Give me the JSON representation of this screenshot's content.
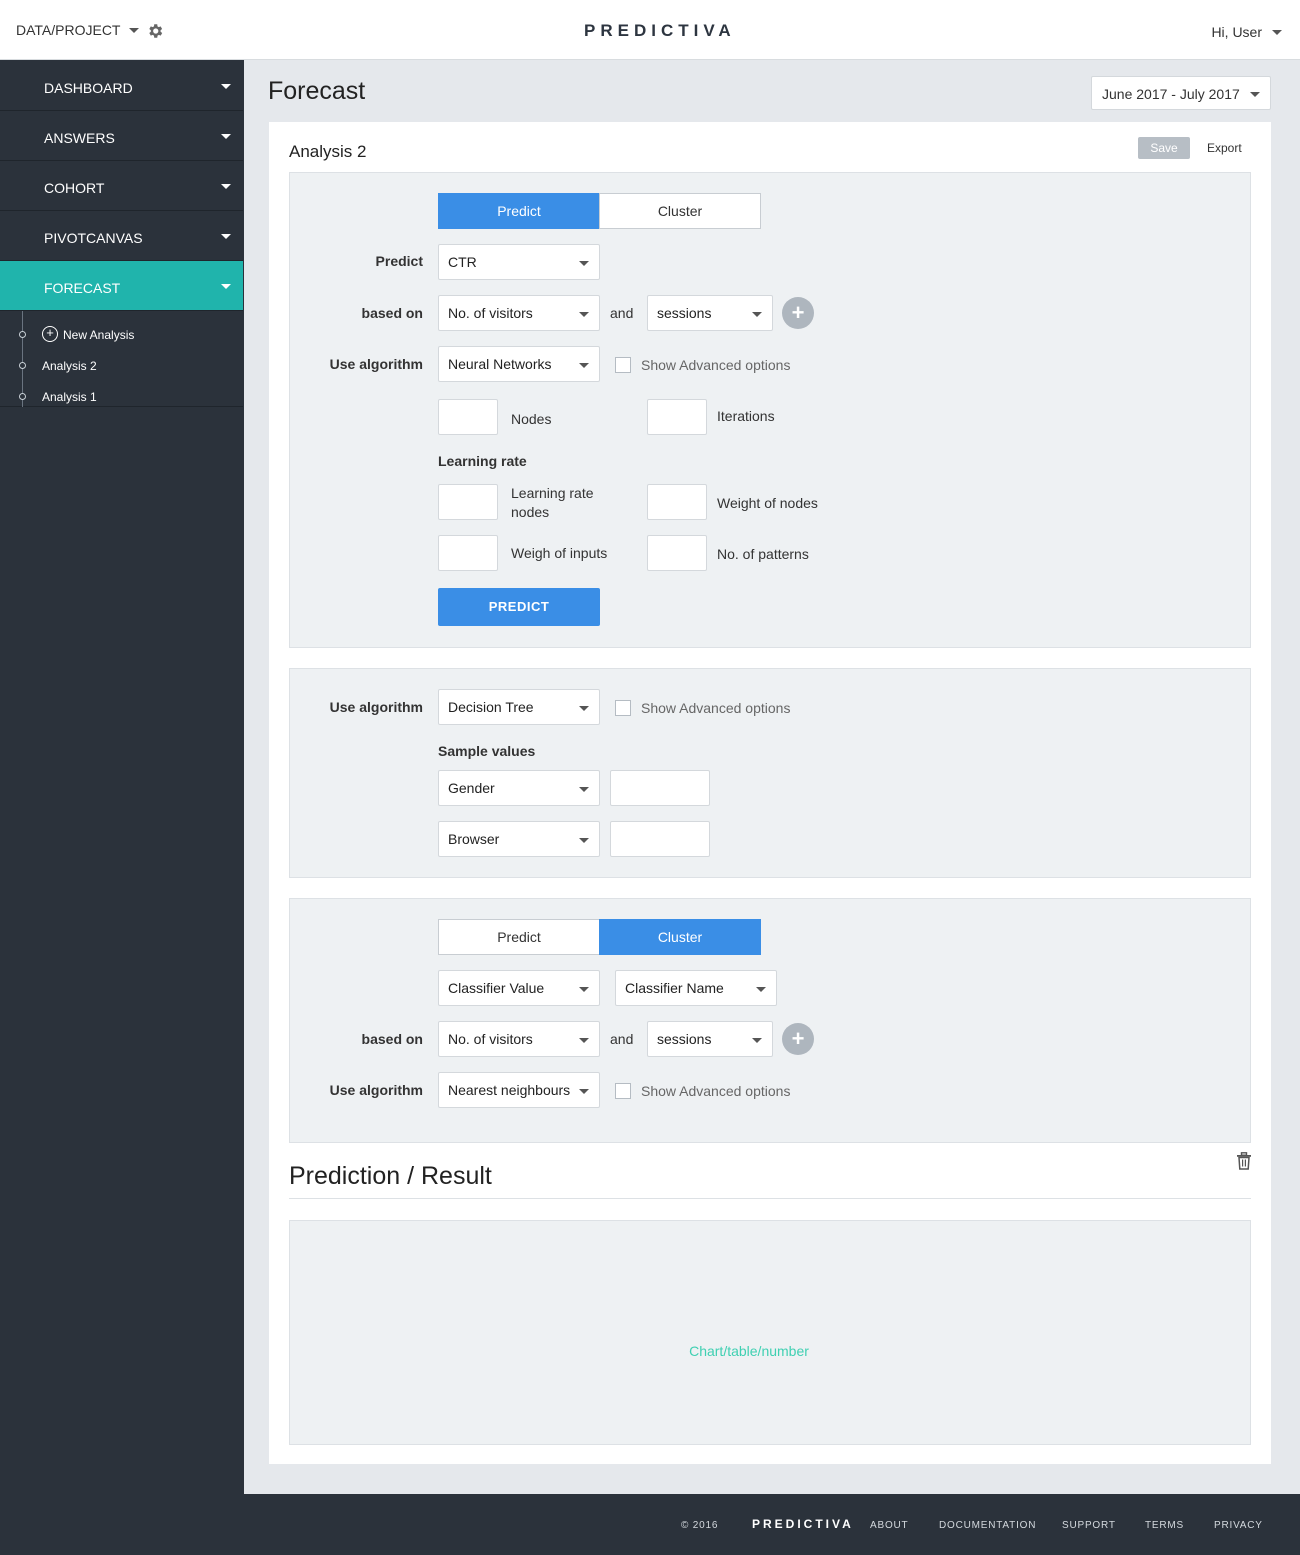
{
  "header": {
    "project_label": "DATA/PROJECT",
    "logo": "PREDICTIVA",
    "user_label": "Hi, User"
  },
  "sidebar": {
    "items": [
      {
        "label": "DASHBOARD"
      },
      {
        "label": "ANSWERS"
      },
      {
        "label": "COHORT"
      },
      {
        "label": "PIVOTCANVAS"
      },
      {
        "label": "FORECAST",
        "active": true
      }
    ],
    "subitems": [
      {
        "label": "New Analysis",
        "icon": "plus-circle-icon"
      },
      {
        "label": "Analysis 2"
      },
      {
        "label": "Analysis 1"
      }
    ]
  },
  "main": {
    "title": "Forecast",
    "date_range": "June 2017 - July 2017",
    "card_title": "Analysis 2",
    "save_label": "Save",
    "export_label": "Export"
  },
  "panel1": {
    "toggle_predict": "Predict",
    "toggle_cluster": "Cluster",
    "predict_label": "Predict",
    "predict_value": "CTR",
    "based_on_label": "based on",
    "based_on_value": "No. of visitors",
    "and_label": "and",
    "and_value": "sessions",
    "algo_label": "Use algorithm",
    "algo_value": "Neural Networks",
    "advanced_label": "Show Advanced options",
    "nodes_label": "Nodes",
    "iterations_label": "Iterations",
    "learning_rate_head": "Learning rate",
    "lr_nodes_label": "Learning rate nodes",
    "weight_nodes_label": "Weight of nodes",
    "weigh_inputs_label": "Weigh of inputs",
    "patterns_label": "No. of patterns",
    "predict_button": "PREDICT"
  },
  "panel2": {
    "algo_label": "Use algorithm",
    "algo_value": "Decision Tree",
    "advanced_label": "Show Advanced options",
    "sample_head": "Sample values",
    "sample1": "Gender",
    "sample2": "Browser"
  },
  "panel3": {
    "toggle_predict": "Predict",
    "toggle_cluster": "Cluster",
    "classifier_value": "Classifier Value",
    "classifier_name": "Classifier Name",
    "based_on_label": "based on",
    "based_on_value": "No. of visitors",
    "and_label": "and",
    "and_value": "sessions",
    "algo_label": "Use algorithm",
    "algo_value": "Nearest neighbours",
    "advanced_label": "Show Advanced options"
  },
  "result": {
    "title": "Prediction / Result",
    "placeholder": "Chart/table/number"
  },
  "footer": {
    "copyright": "© 2016",
    "logo": "PREDICTIVA",
    "links": [
      "ABOUT",
      "DOCUMENTATION",
      "SUPPORT",
      "TERMS",
      "PRIVACY"
    ]
  },
  "colors": {
    "accent": "#3a8ee6",
    "sidebar": "#2b323b",
    "active_nav": "#20b4ac",
    "placeholder_text": "#3fd0b2"
  }
}
